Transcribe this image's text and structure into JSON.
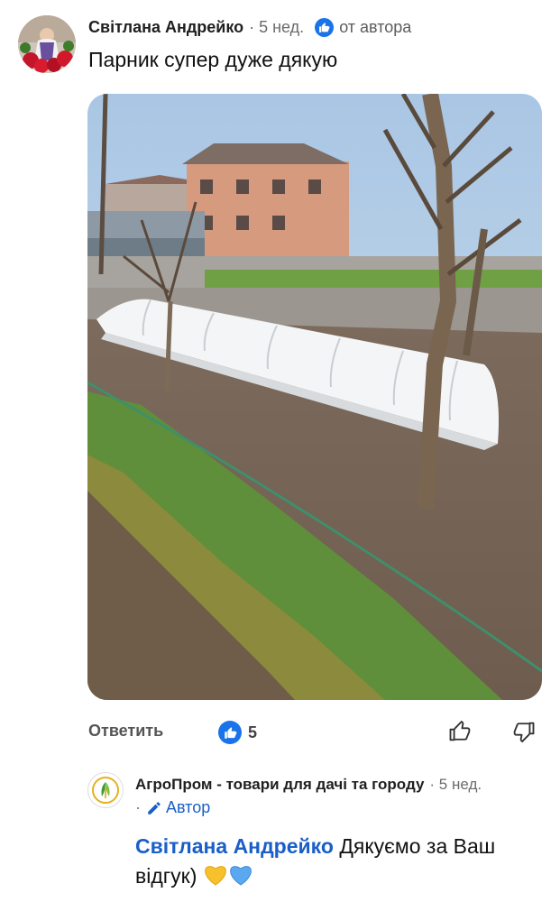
{
  "comment": {
    "author": "Світлана Андрейко",
    "time": "· 5 нед.",
    "author_badge_label": "от автора",
    "text": "Парник супер дуже дякую",
    "photo_alt": "",
    "actions": {
      "reply_label": "Ответить",
      "likes_count": "5"
    }
  },
  "reply": {
    "author": "АгроПром - товари для дачі та городу",
    "time": "· 5 нед.",
    "author_tag": "Автор",
    "mention": "Світлана Андрейко",
    "text": "Дякуємо за Ваш відгук)",
    "emojis": [
      "yellow-heart",
      "blue-heart"
    ]
  },
  "colors": {
    "accent_blue": "#1a73e8",
    "mention_blue": "#1a5fc8",
    "meta_gray": "#6b6b6b"
  },
  "icons": [
    "author-badge-icon",
    "like-badge-icon",
    "thumbs-up-icon",
    "thumbs-down-icon",
    "pencil-icon",
    "agro-logo-icon"
  ]
}
